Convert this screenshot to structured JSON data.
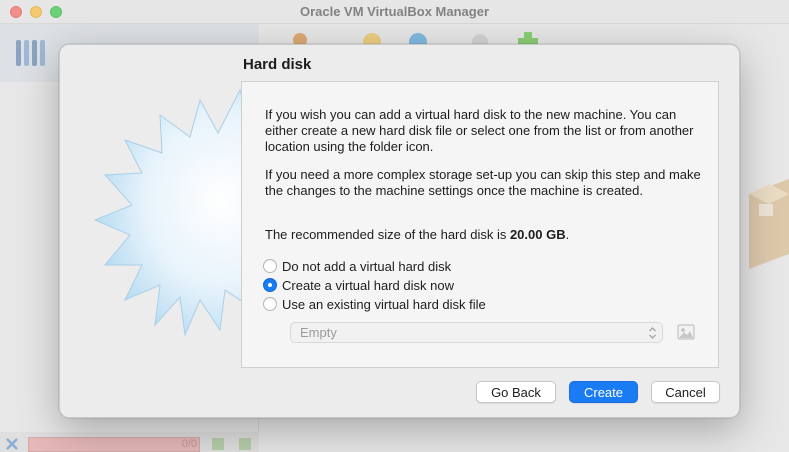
{
  "window": {
    "title": "Oracle VM VirtualBox Manager"
  },
  "dialog": {
    "title": "Hard disk",
    "paragraph1": "If you wish you can add a virtual hard disk to the new machine. You can either create a new hard disk file or select one from the list or from another location using the folder icon.",
    "paragraph2": "If you need a more complex storage set-up you can skip this step and make the changes to the machine settings once the machine is created.",
    "recommended_prefix": "The recommended size of the hard disk is ",
    "recommended_size": "20.00 GB",
    "recommended_suffix": ".",
    "options": [
      {
        "label": "Do not add a virtual hard disk",
        "selected": false
      },
      {
        "label": "Create a virtual hard disk now",
        "selected": true
      },
      {
        "label": "Use an existing virtual hard disk file",
        "selected": false
      }
    ],
    "existing_disk_select": {
      "value": "Empty",
      "enabled": false
    },
    "buttons": {
      "back": "Go Back",
      "create": "Create",
      "cancel": "Cancel"
    }
  },
  "background_status": {
    "progress_text": "0/0"
  },
  "colors": {
    "accent": "#1a7cf5",
    "traffic_close": "#fe5f57",
    "traffic_minimize": "#febc2e",
    "traffic_maximize": "#28c840"
  }
}
